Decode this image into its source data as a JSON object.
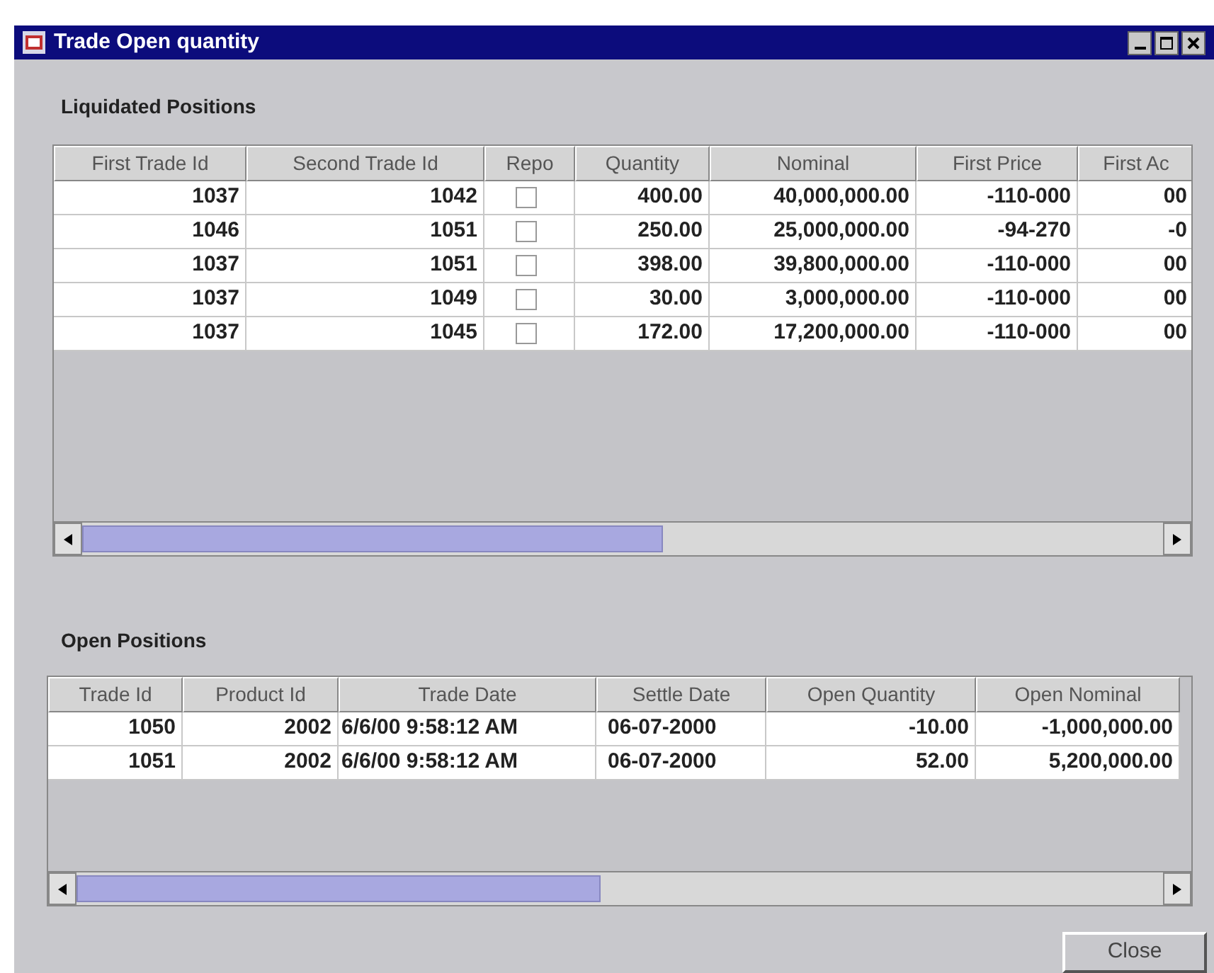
{
  "window": {
    "title": "Trade Open quantity"
  },
  "liquidated": {
    "title": "Liquidated Positions",
    "columns": [
      "First Trade Id",
      "Second Trade Id",
      "Repo",
      "Quantity",
      "Nominal",
      "First Price",
      "First Ac"
    ],
    "rows": [
      {
        "first_trade_id": "1037",
        "second_trade_id": "1042",
        "repo": false,
        "quantity": "400.00",
        "nominal": "40,000,000.00",
        "first_price": "-110-000",
        "column_7": "00"
      },
      {
        "first_trade_id": "1046",
        "second_trade_id": "1051",
        "repo": false,
        "quantity": "250.00",
        "nominal": "25,000,000.00",
        "first_price": "-94-270",
        "column_7": "-0"
      },
      {
        "first_trade_id": "1037",
        "second_trade_id": "1051",
        "repo": false,
        "quantity": "398.00",
        "nominal": "39,800,000.00",
        "first_price": "-110-000",
        "column_7": "00"
      },
      {
        "first_trade_id": "1037",
        "second_trade_id": "1049",
        "repo": false,
        "quantity": "30.00",
        "nominal": "3,000,000.00",
        "first_price": "-110-000",
        "column_7": "00"
      },
      {
        "first_trade_id": "1037",
        "second_trade_id": "1045",
        "repo": false,
        "quantity": "172.00",
        "nominal": "17,200,000.00",
        "first_price": "-110-000",
        "column_7": "00"
      }
    ]
  },
  "open": {
    "title": "Open Positions",
    "columns": [
      "Trade Id",
      "Product Id",
      "Trade Date",
      "Settle Date",
      "Open Quantity",
      "Open Nominal"
    ],
    "rows": [
      {
        "trade_id": "1050",
        "product_id": "2002",
        "trade_date": "6/6/00 9:58:12 AM",
        "settle_date": "06-07-2000",
        "open_quantity": "-10.00",
        "open_nominal": "-1,000,000.00"
      },
      {
        "trade_id": "1051",
        "product_id": "2002",
        "trade_date": "6/6/00 9:58:12 AM",
        "settle_date": "06-07-2000",
        "open_quantity": "52.00",
        "open_nominal": "5,200,000.00"
      }
    ]
  },
  "buttons": [
    "Close"
  ]
}
